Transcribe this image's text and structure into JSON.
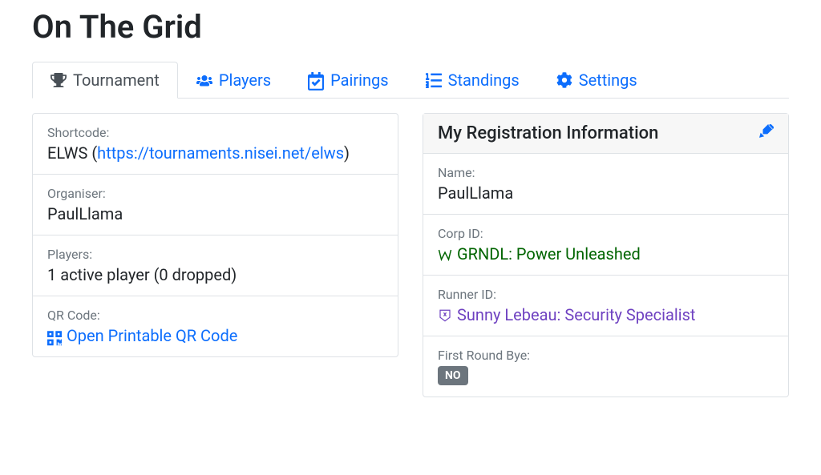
{
  "title": "On The Grid",
  "tabs": {
    "tournament": "Tournament",
    "players": "Players",
    "pairings": "Pairings",
    "standings": "Standings",
    "settings": "Settings"
  },
  "tournament_info": {
    "shortcode_label": "Shortcode:",
    "shortcode_value_prefix": "ELWS (",
    "shortcode_link": "https://tournaments.nisei.net/elws",
    "shortcode_value_suffix": ")",
    "organiser_label": "Organiser:",
    "organiser_value": "PaulLlama",
    "players_label": "Players:",
    "players_value": "1 active player (0 dropped)",
    "qr_label": "QR Code:",
    "qr_link_text": "Open Printable QR Code"
  },
  "registration": {
    "header": "My Registration Information",
    "name_label": "Name:",
    "name_value": "PaulLlama",
    "corp_label": "Corp ID:",
    "corp_value": "GRNDL: Power Unleashed",
    "runner_label": "Runner ID:",
    "runner_value": "Sunny Lebeau: Security Specialist",
    "bye_label": "First Round Bye:",
    "bye_badge": "NO"
  }
}
